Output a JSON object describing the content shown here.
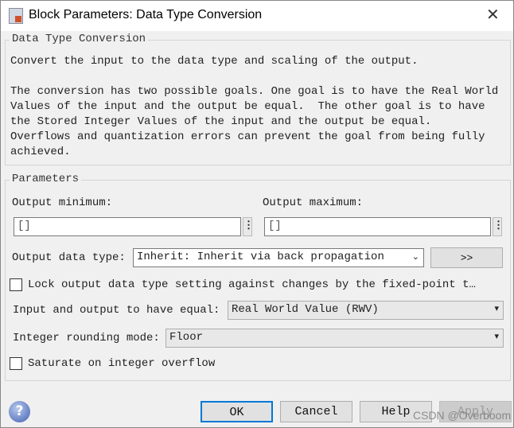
{
  "window": {
    "title": "Block Parameters: Data Type Conversion"
  },
  "description": {
    "legend": "Data Type Conversion",
    "text": "Convert the input to the data type and scaling of the output.\n\nThe conversion has two possible goals. One goal is to have the Real World\nValues of the input and the output be equal.  The other goal is to have\nthe Stored Integer Values of the input and the output be equal.\nOverflows and quantization errors can prevent the goal from being fully\nachieved."
  },
  "parameters": {
    "legend": "Parameters",
    "output_min_label": "Output minimum:",
    "output_min_value": "[]",
    "output_max_label": "Output maximum:",
    "output_max_value": "[]",
    "output_type_label": "Output data type:",
    "output_type_value": "Inherit: Inherit via back propagation",
    "assistant_button": ">>",
    "lock_label": "Lock output data type setting against changes by the fixed-point t…",
    "lock_checked": false,
    "equal_label": "Input and output to have equal:",
    "equal_value": "Real World Value (RWV)",
    "rounding_label": "Integer rounding mode:",
    "rounding_value": "Floor",
    "saturate_label": "Saturate on integer overflow",
    "saturate_checked": false
  },
  "buttons": {
    "ok": "OK",
    "cancel": "Cancel",
    "help": "Help",
    "apply": "Apply"
  },
  "watermark": "CSDN @Overboom"
}
